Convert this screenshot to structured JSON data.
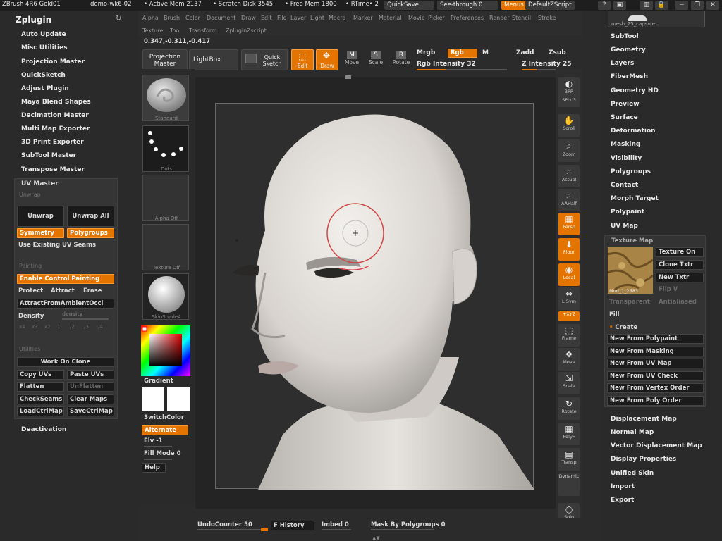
{
  "titlebar": {
    "app": "ZBrush 4R6 Gold01",
    "doc": "demo-wk6-02",
    "active_mem": "• Active Mem 2137",
    "scratch": "• Scratch Disk 3545",
    "free_mem": "• Free Mem 1800",
    "rtime": "• RTime• 2",
    "quicksave": "QuickSave",
    "seethrough": "See-through  0",
    "menus": "Menus",
    "defaultscript": "DefaultZScript"
  },
  "menubar": [
    "Alpha",
    "Brush",
    "Color",
    "Document",
    "Draw",
    "Edit",
    "File",
    "Layer",
    "Light",
    "Macro",
    "Marker",
    "Material",
    "Movie",
    "Picker",
    "Preferences",
    "Render",
    "Stencil",
    "Stroke",
    "Texture",
    "Tool",
    "Transform",
    "Zplugin",
    "Zscript"
  ],
  "coords": "0.347,-0.311,-0.417",
  "left_panel": {
    "title": "Zplugin",
    "items": [
      "Auto Update",
      "Misc Utilities",
      "Projection Master",
      "QuickSketch",
      "Adjust Plugin",
      "Maya Blend Shapes",
      "Decimation Master",
      "Multi Map Exporter",
      "3D Print Exporter",
      "SubTool Master",
      "Transpose Master"
    ],
    "deactivation": "Deactivation",
    "uv_master": {
      "title": "UV Master",
      "unwrap_heading": "Unwrap",
      "unwrap": "Unwrap",
      "unwrap_all": "Unwrap All",
      "symmetry": "Symmetry",
      "polygroups": "Polygroups",
      "use_existing": "Use Existing UV Seams",
      "painting_heading": "Painting",
      "enable_painting": "Enable Control Painting",
      "protect": "Protect",
      "attract": "Attract",
      "erase": "Erase",
      "attract_ao": "AttractFromAmbientOccl",
      "density": "Density",
      "density_slider": "density",
      "density_values": [
        "x4",
        "x3",
        "x2",
        "1",
        "/2",
        "/3",
        "/4"
      ],
      "utilities_heading": "Utilities",
      "work_on_clone": "Work On Clone",
      "copy_uvs": "Copy UVs",
      "paste_uvs": "Paste UVs",
      "flatten": "Flatten",
      "unflatten": "UnFlatten",
      "check_seams": "CheckSeams",
      "clear_maps": "Clear Maps",
      "load_ctrl": "LoadCtrlMap",
      "save_ctrl": "SaveCtrlMap"
    }
  },
  "toolbar": {
    "projection_master": "Projection Master",
    "lightbox": "LightBox",
    "quick_sketch": "Quick Sketch",
    "edit": "Edit",
    "draw": "Draw",
    "move": "Move",
    "scale": "Scale",
    "rotate": "Rotate",
    "mrgb": "Mrgb",
    "rgb": "Rgb",
    "m": "M",
    "zadd": "Zadd",
    "zsub": "Zsub",
    "rgb_intensity": "Rgb Intensity 32",
    "z_intensity": "Z Intensity 25",
    "rgb_intensity_level": 0.32,
    "z_intensity_level": 0.25
  },
  "shelf": {
    "standard": "Standard",
    "dots": "Dots",
    "alpha_off": "Alpha Off",
    "texture_off": "Texture Off",
    "skinshade": "SkinShade4",
    "gradient": "Gradient",
    "switch_color": "SwitchColor",
    "alternate": "Alternate",
    "elv": "Elv -1",
    "fill_mode": "Fill Mode 0",
    "help": "Help"
  },
  "right_tools": [
    {
      "icon": "bpr-icon",
      "label": "BPR"
    },
    {
      "icon": "spix",
      "label": "SPix 3"
    },
    {
      "icon": "scroll-icon",
      "label": "Scroll"
    },
    {
      "icon": "zoom-icon",
      "label": "Zoom"
    },
    {
      "icon": "actual-icon",
      "label": "Actual"
    },
    {
      "icon": "aahalf-icon",
      "label": "AAHalf"
    },
    {
      "icon": "persp-icon",
      "label": "Persp"
    },
    {
      "icon": "floor-icon",
      "label": "Floor"
    },
    {
      "icon": "local-icon",
      "label": "Local"
    },
    {
      "icon": "lsym-icon",
      "label": "L.Sym"
    },
    {
      "icon": "xyz-icon",
      "label": "+XYZ"
    },
    {
      "icon": "frame-icon",
      "label": "Frame"
    },
    {
      "icon": "move-icon",
      "label": "Move"
    },
    {
      "icon": "scale-icon",
      "label": "Scale"
    },
    {
      "icon": "rotate-icon",
      "label": "Rotate"
    },
    {
      "icon": "polyf-icon",
      "label": "PolyF"
    },
    {
      "icon": "transp-icon",
      "label": "Transp"
    },
    {
      "icon": "dynamic-icon",
      "label": "Dynamic"
    },
    {
      "icon": "solo-icon",
      "label": "Solo"
    }
  ],
  "right_panel": {
    "subtool_thumb": "mesh_25_capsule",
    "items_top": [
      "SubTool",
      "Geometry",
      "Layers",
      "FiberMesh",
      "Geometry HD",
      "Preview",
      "Surface",
      "Deformation",
      "Masking",
      "Visibility",
      "Polygroups",
      "Contact",
      "Morph Target",
      "Polypaint",
      "UV Map"
    ],
    "texture_map": {
      "title": "Texture Map",
      "texture_on": "Texture On",
      "clone_txtr": "Clone Txtr",
      "new_txtr": "New Txtr",
      "flip_v": "Flip V",
      "transparent": "Transparent",
      "antialiased": "Antialiased",
      "fill": "Fill",
      "thumb_label": "Mud_1_2583",
      "create": "Create",
      "new_from": [
        "New From Polypaint",
        "New From Masking",
        "New From UV Map",
        "New From UV Check",
        "New From Vertex Order",
        "New From Poly Order"
      ]
    },
    "items_bottom": [
      "Displacement Map",
      "Normal Map",
      "Vector Displacement Map",
      "Display Properties",
      "Unified Skin",
      "Import",
      "Export"
    ]
  },
  "bottom_bar": {
    "undo": "UndoCounter 50",
    "history": "F History",
    "imbed": "Imbed 0",
    "mask_by_polygroups": "Mask By Polygroups 0"
  },
  "colors": {
    "accent": "#e47400",
    "panel": "#2a2a2a",
    "canvas": "#242424"
  }
}
